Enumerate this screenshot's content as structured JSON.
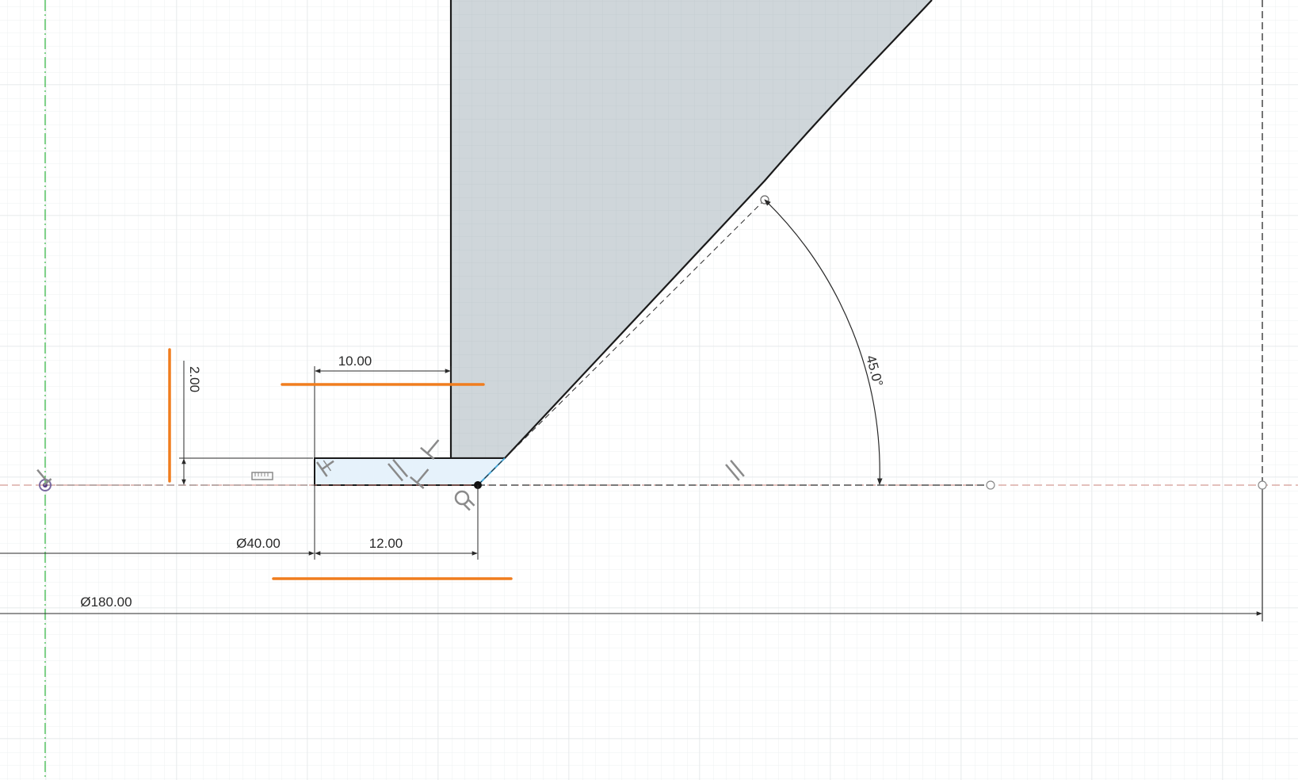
{
  "app": {
    "context": "CAD sketch workspace"
  },
  "colors": {
    "grid_minor": "#eef0f2",
    "grid_major": "#dfe3e6",
    "profile_fill": "#cfd6da",
    "profile_edge": "#1a1a1a",
    "selected_fill": "#e6f2fb",
    "selected_edge": "#48a8d8",
    "highlight": "#f07d1e",
    "axis_y": "#3cb84a",
    "axis_x": "#c9827a",
    "dim_line": "#2a2a2a",
    "constraint_icon": "#8a8a8a"
  },
  "dimensions": {
    "width_top": "10.00",
    "height_left": "2.00",
    "diameter_inner": "Ø40.00",
    "width_bottom": "12.00",
    "diameter_outer": "Ø180.00",
    "angle": "45.0°"
  },
  "constraints": [
    {
      "type": "horizontal",
      "icon": "horizontal-constraint-icon"
    },
    {
      "type": "perpendicular",
      "icon": "perpendicular-constraint-icon"
    },
    {
      "type": "parallel",
      "icon": "parallel-constraint-icon"
    },
    {
      "type": "perpendicular",
      "icon": "perpendicular-constraint-icon"
    },
    {
      "type": "tangent",
      "icon": "tangent-constraint-icon"
    },
    {
      "type": "parallel",
      "icon": "parallel-constraint-icon"
    },
    {
      "type": "fix",
      "icon": "fix-constraint-icon"
    },
    {
      "type": "midpoint",
      "icon": "midpoint-constraint-icon"
    }
  ]
}
